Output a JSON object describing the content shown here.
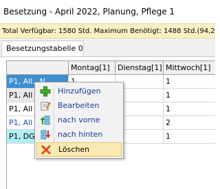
{
  "window": {
    "title": "Besetzung - April 2022, Planung, Pflege 1"
  },
  "infobar": {
    "text": "Total Verfügbar: 1580 Std.  Maximum Benötigt: 1488 Std.(94,2 %)"
  },
  "tabs": [
    {
      "label": "Besetzungstabelle 0"
    }
  ],
  "grid": {
    "columns": [
      "",
      "Montag[1]",
      "Dienstag[1]",
      "Mittwoch[1]"
    ],
    "rows": [
      {
        "label": "P1, All...N",
        "montag": "1",
        "dienstag": "",
        "mittwoch": "1"
      },
      {
        "label": "P1, All",
        "montag": "",
        "dienstag": "",
        "mittwoch": "1"
      },
      {
        "label": "P1, All",
        "montag": "",
        "dienstag": "",
        "mittwoch": "1"
      },
      {
        "label": "P1, All",
        "montag": "",
        "dienstag": "",
        "mittwoch": "2"
      },
      {
        "label": "P1, DG",
        "montag": "",
        "dienstag": "",
        "mittwoch": "1"
      }
    ]
  },
  "context_menu": {
    "items": [
      {
        "label": "Hinzufügen",
        "icon": "plus-icon"
      },
      {
        "label": "Bearbeiten",
        "icon": "edit-icon"
      },
      {
        "label": "nach vorne",
        "icon": "move-up-icon"
      },
      {
        "label": "nach hinten",
        "icon": "move-down-icon"
      },
      {
        "label": "Löschen",
        "icon": "delete-x-icon",
        "highlighted": true
      }
    ]
  },
  "colors": {
    "infobar_bg": "#fbf0c4",
    "selected_row": "#3d8fd1",
    "cyan_row": "#aef0f5",
    "menu_highlight": "#fbe9b3"
  }
}
